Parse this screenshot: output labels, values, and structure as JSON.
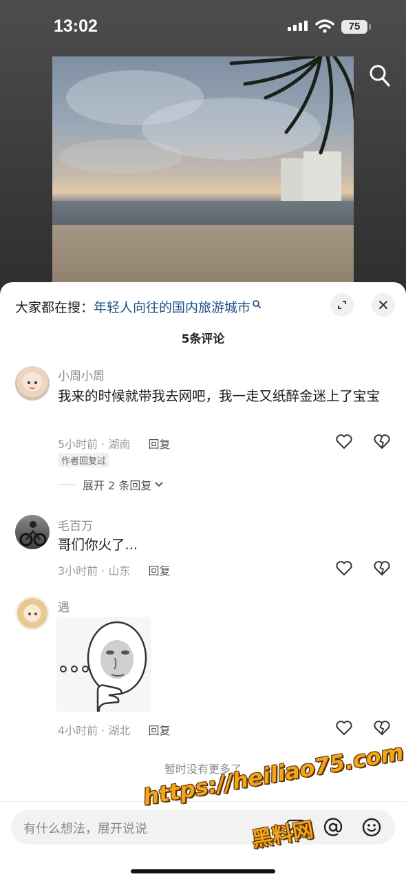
{
  "status_bar": {
    "time": "13:02",
    "battery": "75"
  },
  "search_hint": {
    "prefix": "大家都在搜：",
    "query": "年轻人向往的国内旅游城市"
  },
  "sheet": {
    "title": "5条评论",
    "no_more": "暂时没有更多了"
  },
  "comments": [
    {
      "user": "小周小周",
      "text": "我来的时候就带我去网吧，我一走又纸醉金迷上了宝宝",
      "time_location": "5小时前 · 湖南",
      "reply_label": "回复",
      "tag": "作者回复过",
      "expand": "展开 2 条回复"
    },
    {
      "user": "毛百万",
      "text": "哥们你火了...",
      "time_location": "3小时前 · 山东",
      "reply_label": "回复"
    },
    {
      "user": "遇",
      "sticker": "thinking-face-sticker",
      "time_location": "4小时前 · 湖北",
      "reply_label": "回复"
    }
  ],
  "input": {
    "placeholder": "有什么想法，展开说说"
  },
  "watermark": {
    "line1": "https://heiliao75.com",
    "line2": "黑料网"
  },
  "icons": [
    "search-icon",
    "expand-icon",
    "close-icon",
    "heart-icon",
    "broken-heart-icon",
    "image-icon",
    "at-icon",
    "emoji-icon"
  ],
  "colors": {
    "link": "#1f4f86",
    "watermark": "#f2a51d"
  }
}
